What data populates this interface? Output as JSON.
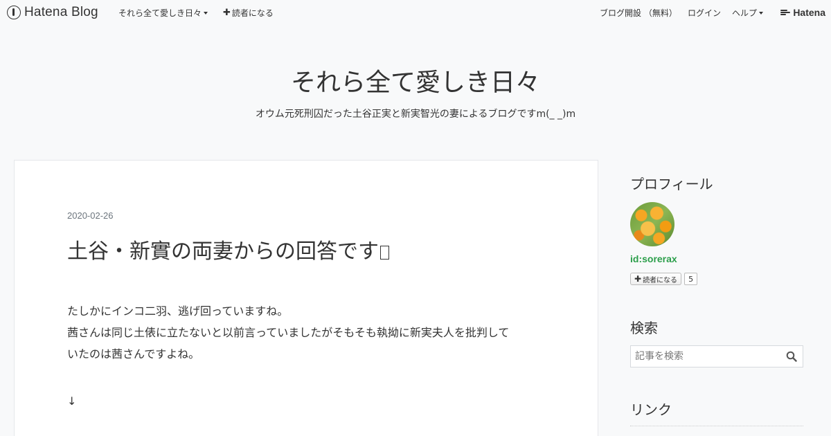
{
  "topbar": {
    "brand": "Hatena Blog",
    "blog_menu": "それら全て愛しき日々",
    "subscribe": "読者になる",
    "open_blog": "ブログ開設 （無料）",
    "login": "ログイン",
    "help": "ヘルプ",
    "hatena": "Hatena"
  },
  "header": {
    "title": "それら全て愛しき日々",
    "description": "オウム元死刑囚だった土谷正実と新実智光の妻によるブログですm(_ _)m"
  },
  "post": {
    "date": "2020-02-26",
    "title": "土谷・新實の両妻からの回答です",
    "body_lines": [
      "たしかにインコ二羽、逃げ回っていますね。",
      "茜さんは同じ土俵に立たないと以前言っていましたがそもそも執拗に新実夫人を批判して",
      "いたのは茜さんですよね。"
    ],
    "arrow": "↓"
  },
  "sidebar": {
    "profile_heading": "プロフィール",
    "profile_id": "id:sorerax",
    "subscribe_label": "読者になる",
    "subscriber_count": "5",
    "search_heading": "検索",
    "search_placeholder": "記事を検索",
    "link_heading": "リンク"
  },
  "colors": {
    "background": "#f8f9fa",
    "card": "#ffffff",
    "profile_id": "#2b9e4a",
    "date": "#6c757d"
  }
}
